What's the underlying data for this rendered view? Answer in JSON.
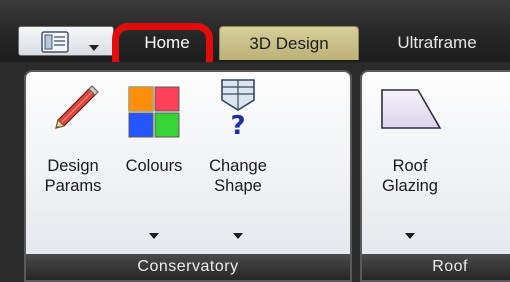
{
  "tabs": {
    "home": "Home",
    "design3d": "3D Design",
    "ultraframe": "Ultraframe"
  },
  "groups": {
    "conservatory": "Conservatory",
    "roof": "Roof"
  },
  "buttons": {
    "design_params": {
      "line1": "Design",
      "line2": "Params"
    },
    "colours": {
      "line1": "Colours"
    },
    "change_shape": {
      "line1": "Change",
      "line2": "Shape"
    },
    "roof_glazing": {
      "line1": "Roof",
      "line2": "Glazing"
    }
  },
  "colors": {
    "highlight": "#e30c0c",
    "active_tab": "#c9c08a",
    "colours_tiles": [
      "#ff0000",
      "#ff3b4f",
      "#1f4fff",
      "#2ed32e"
    ]
  },
  "icons": [
    "document-icon",
    "dropdown-arrow-icon",
    "pencil-icon",
    "colour-grid-icon",
    "shape-question-icon",
    "roof-panel-icon"
  ]
}
